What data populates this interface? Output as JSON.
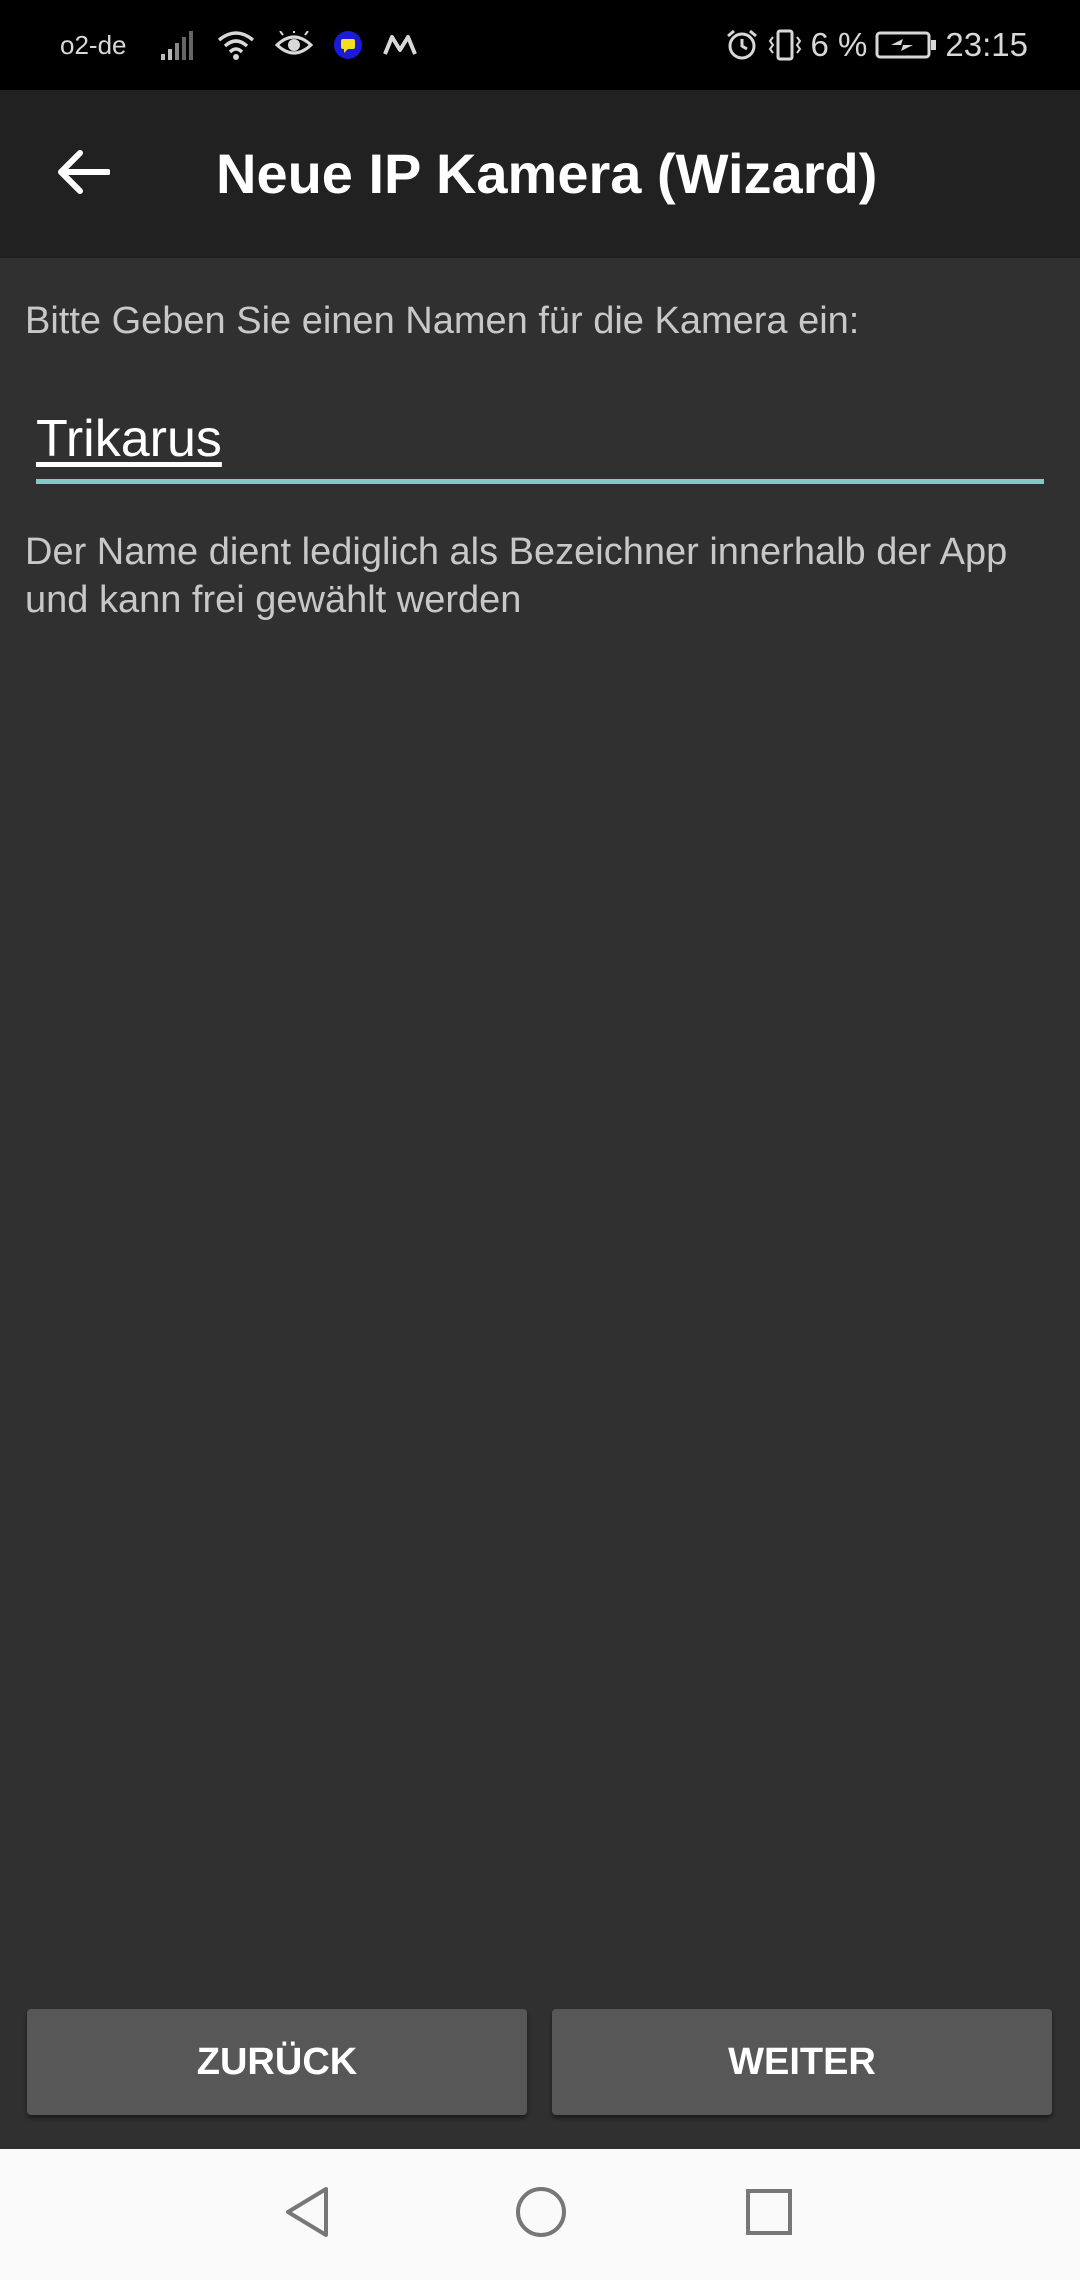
{
  "status_bar": {
    "carrier": "o2-de",
    "battery": "6 %",
    "time": "23:15",
    "icons_left": [
      "signal-icon",
      "wifi-icon",
      "eye-icon",
      "chat-app-icon",
      "m-app-icon"
    ],
    "icons_right": [
      "alarm-icon",
      "vibrate-icon",
      "battery-charging-icon"
    ]
  },
  "app_bar": {
    "title": "Neue IP Kamera (Wizard)",
    "back_icon": "arrow-left-icon"
  },
  "form": {
    "prompt": "Bitte Geben Sie einen Namen für die Kamera ein:",
    "name_value": "Trikarus",
    "hint": "Der Name dient lediglich als Bezeichner innerhalb der App und kann frei gewählt werden"
  },
  "buttons": {
    "back_label": "ZURÜCK",
    "next_label": "WEITER"
  },
  "nav_bar": {
    "icons": [
      "nav-back-icon",
      "nav-home-icon",
      "nav-recents-icon"
    ]
  },
  "colors": {
    "background": "#303030",
    "app_bar": "#212121",
    "accent": "#80cbc4",
    "button": "#575757"
  }
}
